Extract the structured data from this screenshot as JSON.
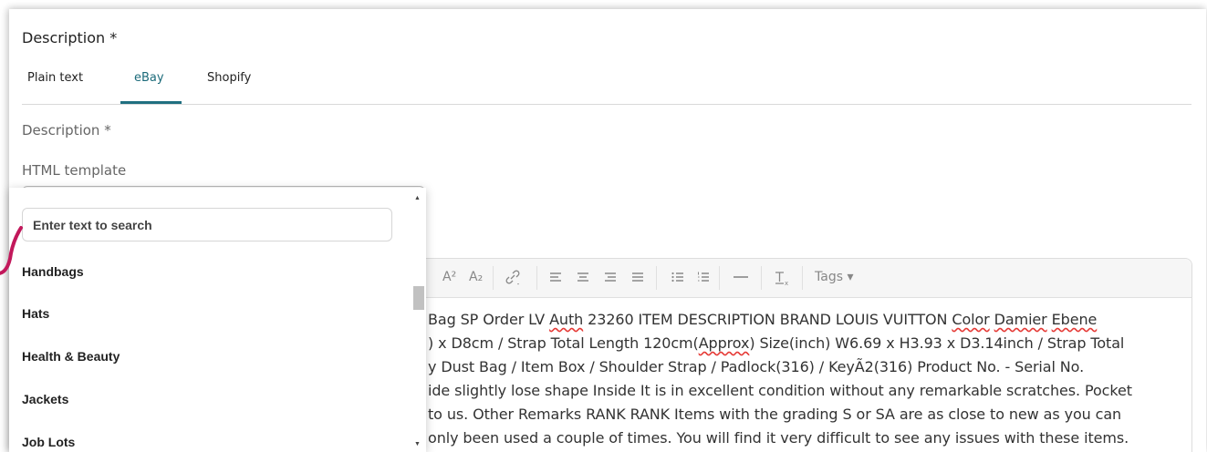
{
  "section": {
    "title": "Description *"
  },
  "tabs": [
    {
      "label": "Plain text",
      "active": false
    },
    {
      "label": "eBay",
      "active": true
    },
    {
      "label": "Shopify",
      "active": false
    }
  ],
  "fields": {
    "description_label": "Description *",
    "html_template_label": "HTML template"
  },
  "toolbar": {
    "superscript": "A²",
    "subscript": "A₂",
    "tags_label": "Tags ▾"
  },
  "editor": {
    "lines": [
      "Bag SP Order LV Auth 23260 ITEM DESCRIPTION BRAND LOUIS VUITTON Color Damier Ebene",
      ") x D8cm / Strap Total Length 120cm(Approx) Size(inch) W6.69 x H3.93 x D3.14inch / Strap Total",
      "y Dust Bag / Item Box / Shoulder Strap / Padlock(316) / KeyÃ2(316) Product No. - Serial No.",
      "ide slightly lose shape Inside It is in excellent condition without any remarkable scratches. Pocket",
      "to us. Other Remarks RANK RANK Items with the grading S or SA are as close to new as you can",
      "only been used a couple of times. You will find it very difficult to see any issues with these items."
    ]
  },
  "dropdown": {
    "search_placeholder": "Enter text to search",
    "items": [
      "Handbags",
      "Hats",
      "Health & Beauty",
      "Jackets",
      "Job Lots"
    ]
  },
  "colors": {
    "accent": "#1f6f80",
    "pink_annotation": "#c2185b",
    "spellcheck": "#e53935"
  }
}
